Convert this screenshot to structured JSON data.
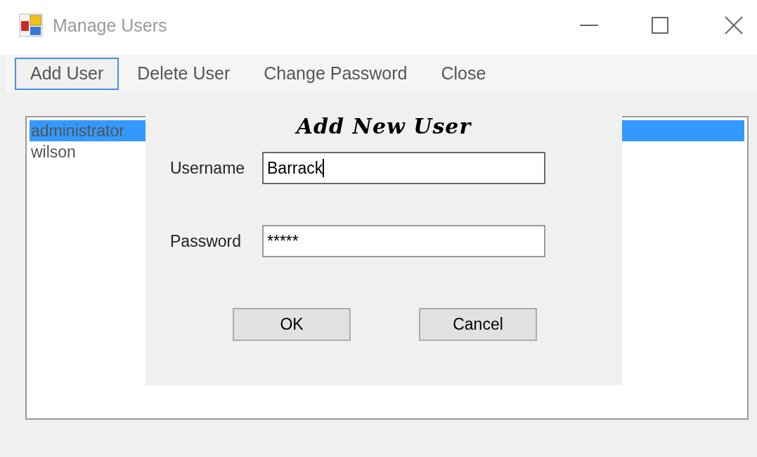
{
  "window": {
    "title": "Manage Users"
  },
  "menu": [
    {
      "label": "Add User",
      "selected": true
    },
    {
      "label": "Delete User",
      "selected": false
    },
    {
      "label": "Change Password",
      "selected": false
    },
    {
      "label": "Close",
      "selected": false
    }
  ],
  "users": [
    {
      "name": "administrator",
      "selected": true
    },
    {
      "name": "wilson",
      "selected": false
    }
  ],
  "dialog": {
    "title": "Add New User",
    "fields": [
      {
        "label": "Username",
        "value": "Barrack",
        "focused": true
      },
      {
        "label": "Password",
        "value": "*****",
        "focused": false
      }
    ],
    "buttons": [
      "OK",
      "Cancel"
    ]
  }
}
